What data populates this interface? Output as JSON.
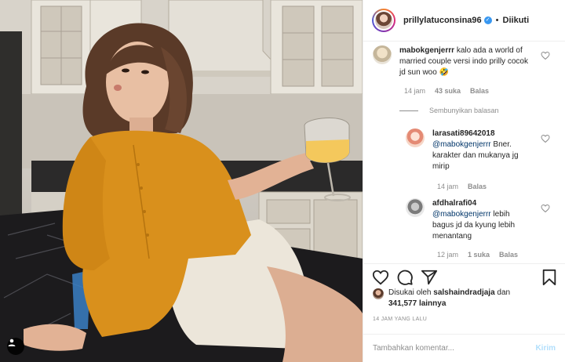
{
  "post": {
    "username": "prillylatuconsina96",
    "separator": "•",
    "follow_status": "Diikuti",
    "photo_icon": "user-tag-icon"
  },
  "comments": [
    {
      "username": "mabokgenjerrr",
      "text": "kalo ada a world of married couple versi indo prilly cocok jd sun woo 🤣",
      "time": "14 jam",
      "likes": "43 suka",
      "reply": "Balas"
    }
  ],
  "hide_replies": "Sembunyikan balasan",
  "replies": [
    {
      "username": "larasati89642018",
      "mention": "@mabokgenjerrr",
      "text": "Bner. karakter dan mukanya jg mirip",
      "time": "14 jam",
      "reply": "Balas"
    },
    {
      "username": "afdhalrafi04",
      "mention": "@mabokgenjerrr",
      "text": "lebih bagus jd da kyung lebih menantang",
      "time": "12 jam",
      "likes": "1 suka",
      "reply": "Balas"
    }
  ],
  "likes_line": {
    "prefix": "Disukai oleh",
    "user": "salshaindradjaja",
    "conj": "dan",
    "count": "341,577",
    "suffix": "lainnya"
  },
  "time_ago": "14 JAM YANG LALU",
  "add_comment": {
    "placeholder": "Tambahkan komentar...",
    "post_label": "Kirim"
  },
  "colors": {
    "verified": "#3897f0",
    "mention": "#003569",
    "post_disabled": "#b2dffc",
    "blouse": "#d9901c"
  }
}
